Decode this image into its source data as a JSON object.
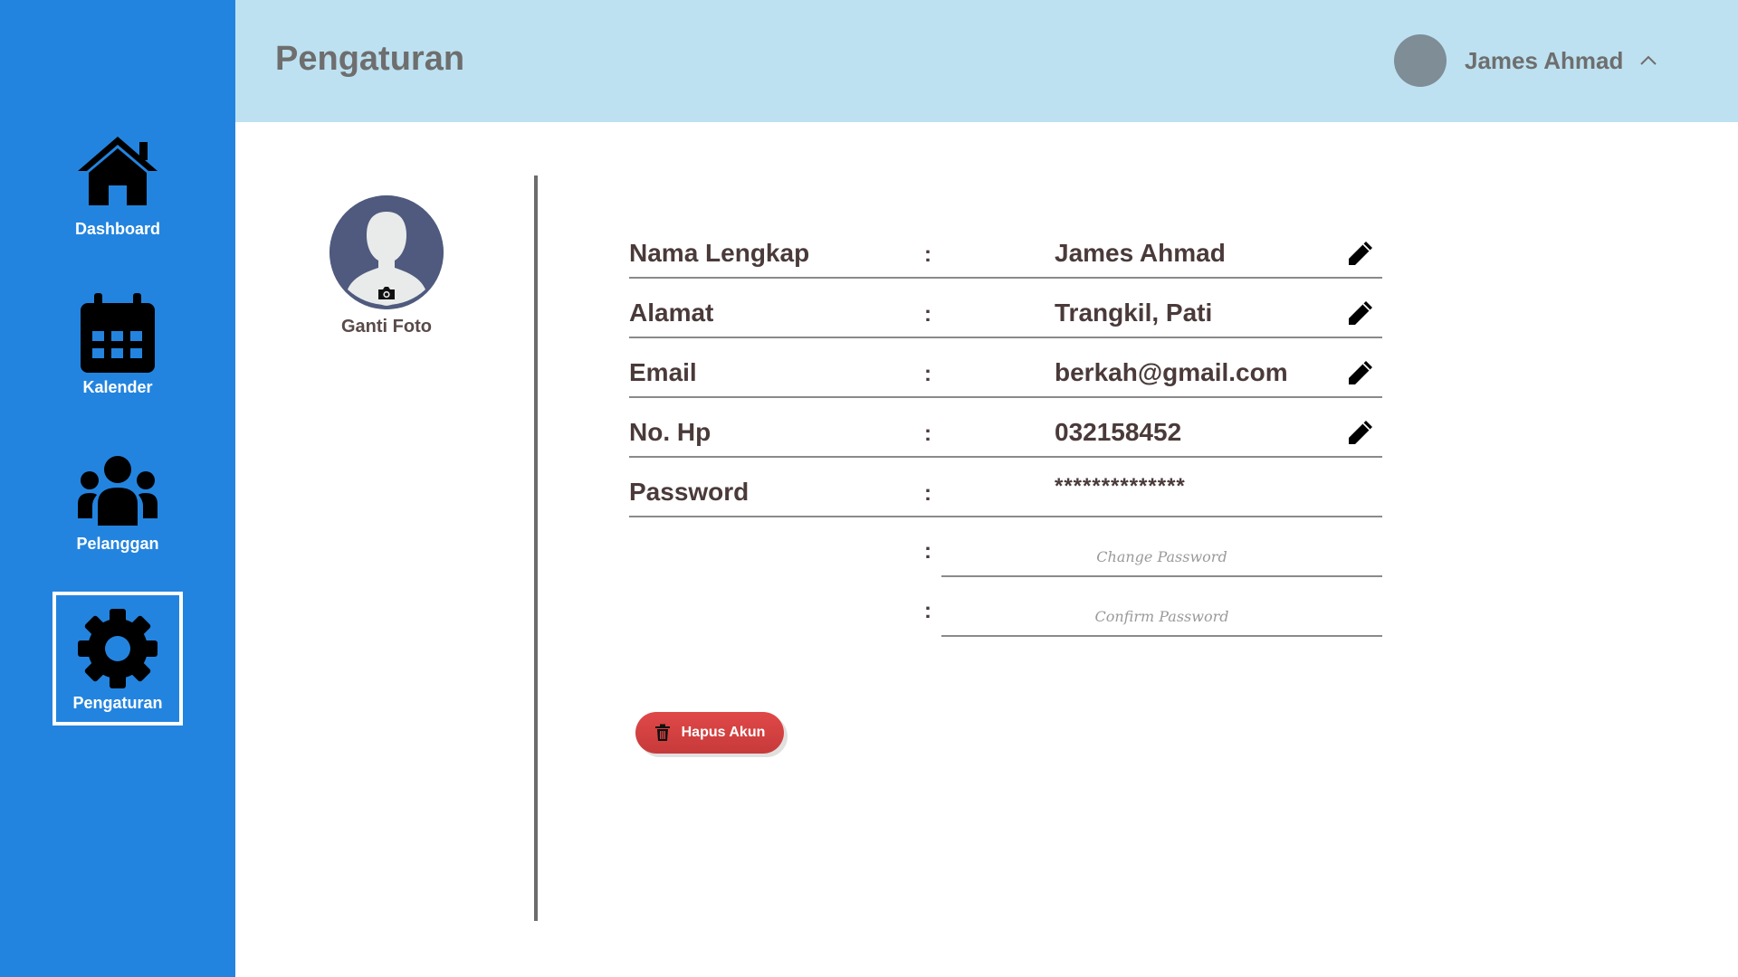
{
  "sidebar": {
    "items": [
      {
        "label": "Dashboard",
        "icon": "home-icon"
      },
      {
        "label": "Kalender",
        "icon": "calendar-icon"
      },
      {
        "label": "Pelanggan",
        "icon": "users-icon"
      },
      {
        "label": "Pengaturan",
        "icon": "gear-icon",
        "active": true
      }
    ]
  },
  "header": {
    "title": "Pengaturan",
    "user_name": "James Ahmad"
  },
  "profile": {
    "change_photo_label": "Ganti Foto"
  },
  "form": {
    "separator": ":",
    "fields": [
      {
        "label": "Nama Lengkap",
        "value": "James Ahmad"
      },
      {
        "label": "Alamat",
        "value": "Trangkil, Pati"
      },
      {
        "label": "Email",
        "value": "berkah@gmail.com"
      },
      {
        "label": "No. Hp",
        "value": "032158452"
      },
      {
        "label": "Password",
        "value": "**************"
      }
    ],
    "change_password_placeholder": "Change Password",
    "confirm_password_placeholder": "Confirm Password"
  },
  "actions": {
    "delete_account_label": "Hapus Akun"
  },
  "colors": {
    "sidebar": "#2384df",
    "header": "#bde1f1",
    "danger": "#d94343",
    "text": "#4a3a3a"
  }
}
